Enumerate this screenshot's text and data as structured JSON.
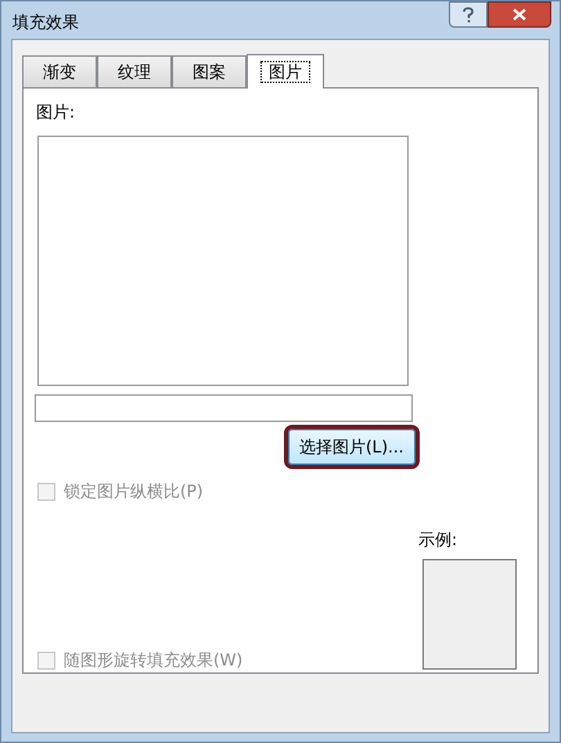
{
  "window": {
    "title": "填充效果"
  },
  "tabs": [
    {
      "label": "渐变",
      "selected": false
    },
    {
      "label": "纹理",
      "selected": false
    },
    {
      "label": "图案",
      "selected": false
    },
    {
      "label": "图片",
      "selected": true
    }
  ],
  "picture_label": "图片:",
  "select_button": {
    "label": "选择图片(L)...",
    "highlighted": true
  },
  "options": [
    {
      "label": "锁定图片纵横比(P)",
      "checked": false,
      "disabled": true
    },
    {
      "label": "随图形旋转填充效果(W)",
      "checked": false,
      "disabled": true
    }
  ],
  "sample_label": "示例:"
}
